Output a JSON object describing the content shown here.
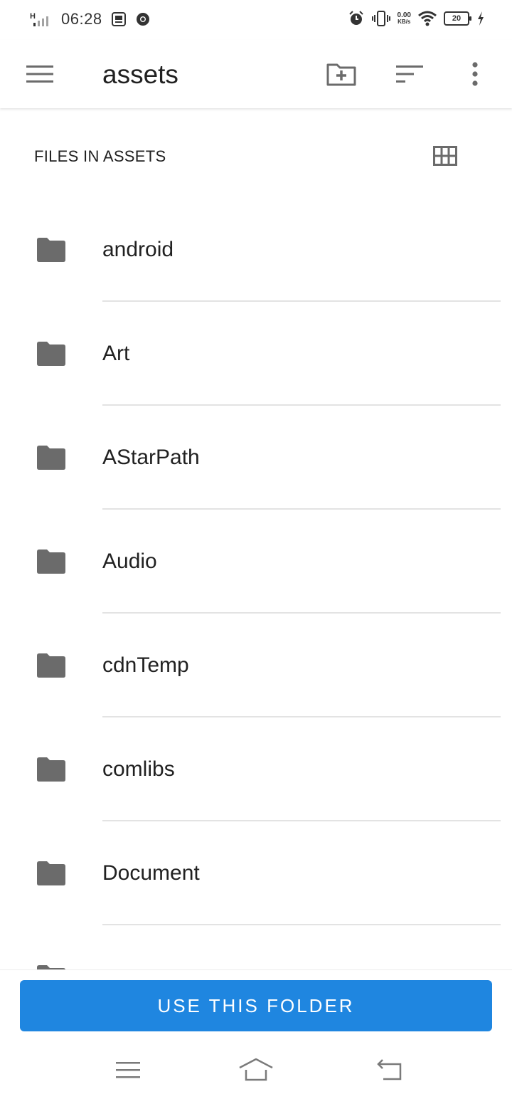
{
  "status_bar": {
    "network_type": "H",
    "time": "06:28",
    "net_speed_value": "0.00",
    "net_speed_unit": "KB/s",
    "battery_level": "20",
    "left_icons": [
      "gallery-icon",
      "chrome-icon"
    ],
    "right_icons": [
      "alarm-icon",
      "vibrate-icon",
      "wifi-icon",
      "charging-icon"
    ]
  },
  "app_bar": {
    "title": "assets",
    "icons": [
      "menu-icon",
      "new-folder-icon",
      "sort-icon",
      "more-options-icon"
    ]
  },
  "section": {
    "title": "FILES IN ASSETS",
    "view_toggle_icon": "grid-view-icon"
  },
  "files": [
    {
      "name": "android",
      "icon": "folder-icon"
    },
    {
      "name": "Art",
      "icon": "folder-icon"
    },
    {
      "name": "AStarPath",
      "icon": "folder-icon"
    },
    {
      "name": "Audio",
      "icon": "folder-icon"
    },
    {
      "name": "cdnTemp",
      "icon": "folder-icon"
    },
    {
      "name": "comlibs",
      "icon": "folder-icon"
    },
    {
      "name": "Document",
      "icon": "folder-icon"
    },
    {
      "name": "",
      "icon": "folder-icon"
    }
  ],
  "action_button": {
    "label": "USE THIS FOLDER"
  },
  "nav_bar": {
    "icons": [
      "recents-icon",
      "home-icon",
      "back-icon"
    ]
  },
  "colors": {
    "accent": "#1f86e0",
    "icon_gray": "#6b6b6b",
    "divider": "#e3e3e3",
    "text": "#212121"
  }
}
